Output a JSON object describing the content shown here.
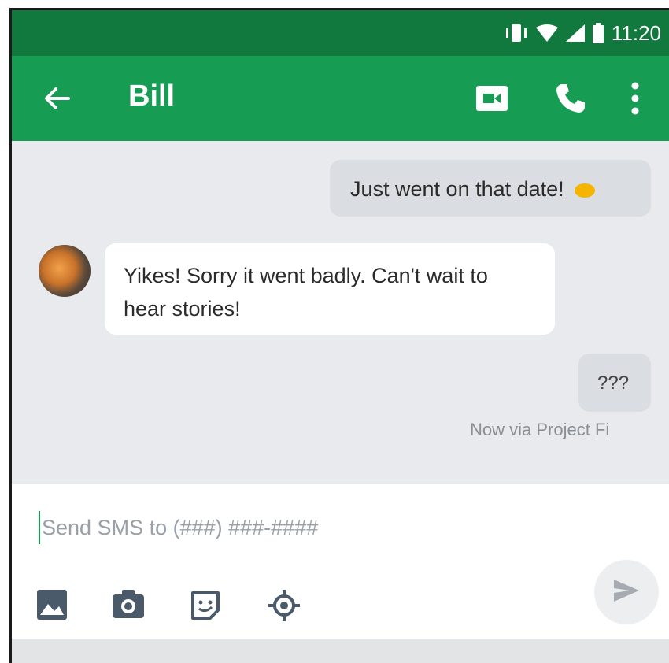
{
  "status_bar": {
    "time": "11:20",
    "icons": [
      "vibrate-icon",
      "wifi-icon",
      "signal-icon",
      "battery-icon"
    ]
  },
  "app_bar": {
    "title": "Bill",
    "icons": [
      "back-arrow-icon",
      "video-call-icon",
      "phone-icon",
      "more-vert-icon"
    ],
    "color": "#169c53"
  },
  "messages": [
    {
      "direction": "outgoing",
      "text": "Just went on that date!",
      "emoji": "lips-emoji"
    },
    {
      "direction": "incoming",
      "lines": [
        "Yikes! Sorry it went badly. Can't wait to",
        "hear stories!"
      ]
    },
    {
      "direction": "outgoing",
      "text": "???",
      "meta": "Now via Project Fi"
    }
  ],
  "composer": {
    "placeholder": "Send SMS to (###) ###-####",
    "tools": [
      "gallery-icon",
      "camera-icon",
      "sticker-icon",
      "location-icon"
    ],
    "send_icon": "send-icon"
  }
}
